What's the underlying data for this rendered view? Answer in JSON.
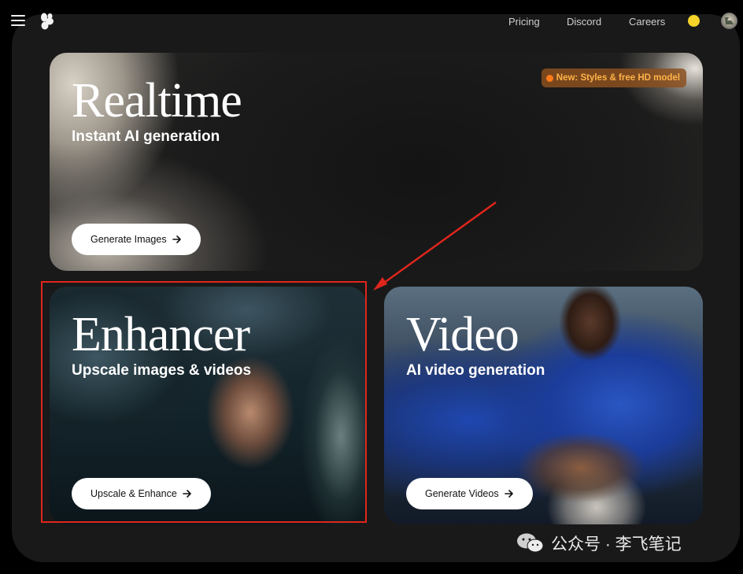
{
  "nav": {
    "links": [
      "Pricing",
      "Discord",
      "Careers"
    ]
  },
  "icons": {
    "menu": "hamburger-icon",
    "logo": "krea-logo-icon",
    "coin": "coin-icon",
    "avatar": "user-avatar",
    "arrow": "arrow-right-icon"
  },
  "colors": {
    "page_bg": "#000000",
    "panel_bg": "#191919",
    "badge_text": "#ffb347",
    "highlight": "#e0261c",
    "coin": "#f6d42a"
  },
  "cards": {
    "realtime": {
      "title": "Realtime",
      "subtitle": "Instant AI generation",
      "button": "Generate Images",
      "badge": "New: Styles & free HD model"
    },
    "enhancer": {
      "title": "Enhancer",
      "subtitle": "Upscale images & videos",
      "button": "Upscale & Enhance"
    },
    "video": {
      "title": "Video",
      "subtitle": "AI video generation",
      "button": "Generate Videos"
    }
  },
  "watermark": {
    "text": "公众号 · 李飞笔记",
    "icon": "wechat-icon"
  }
}
